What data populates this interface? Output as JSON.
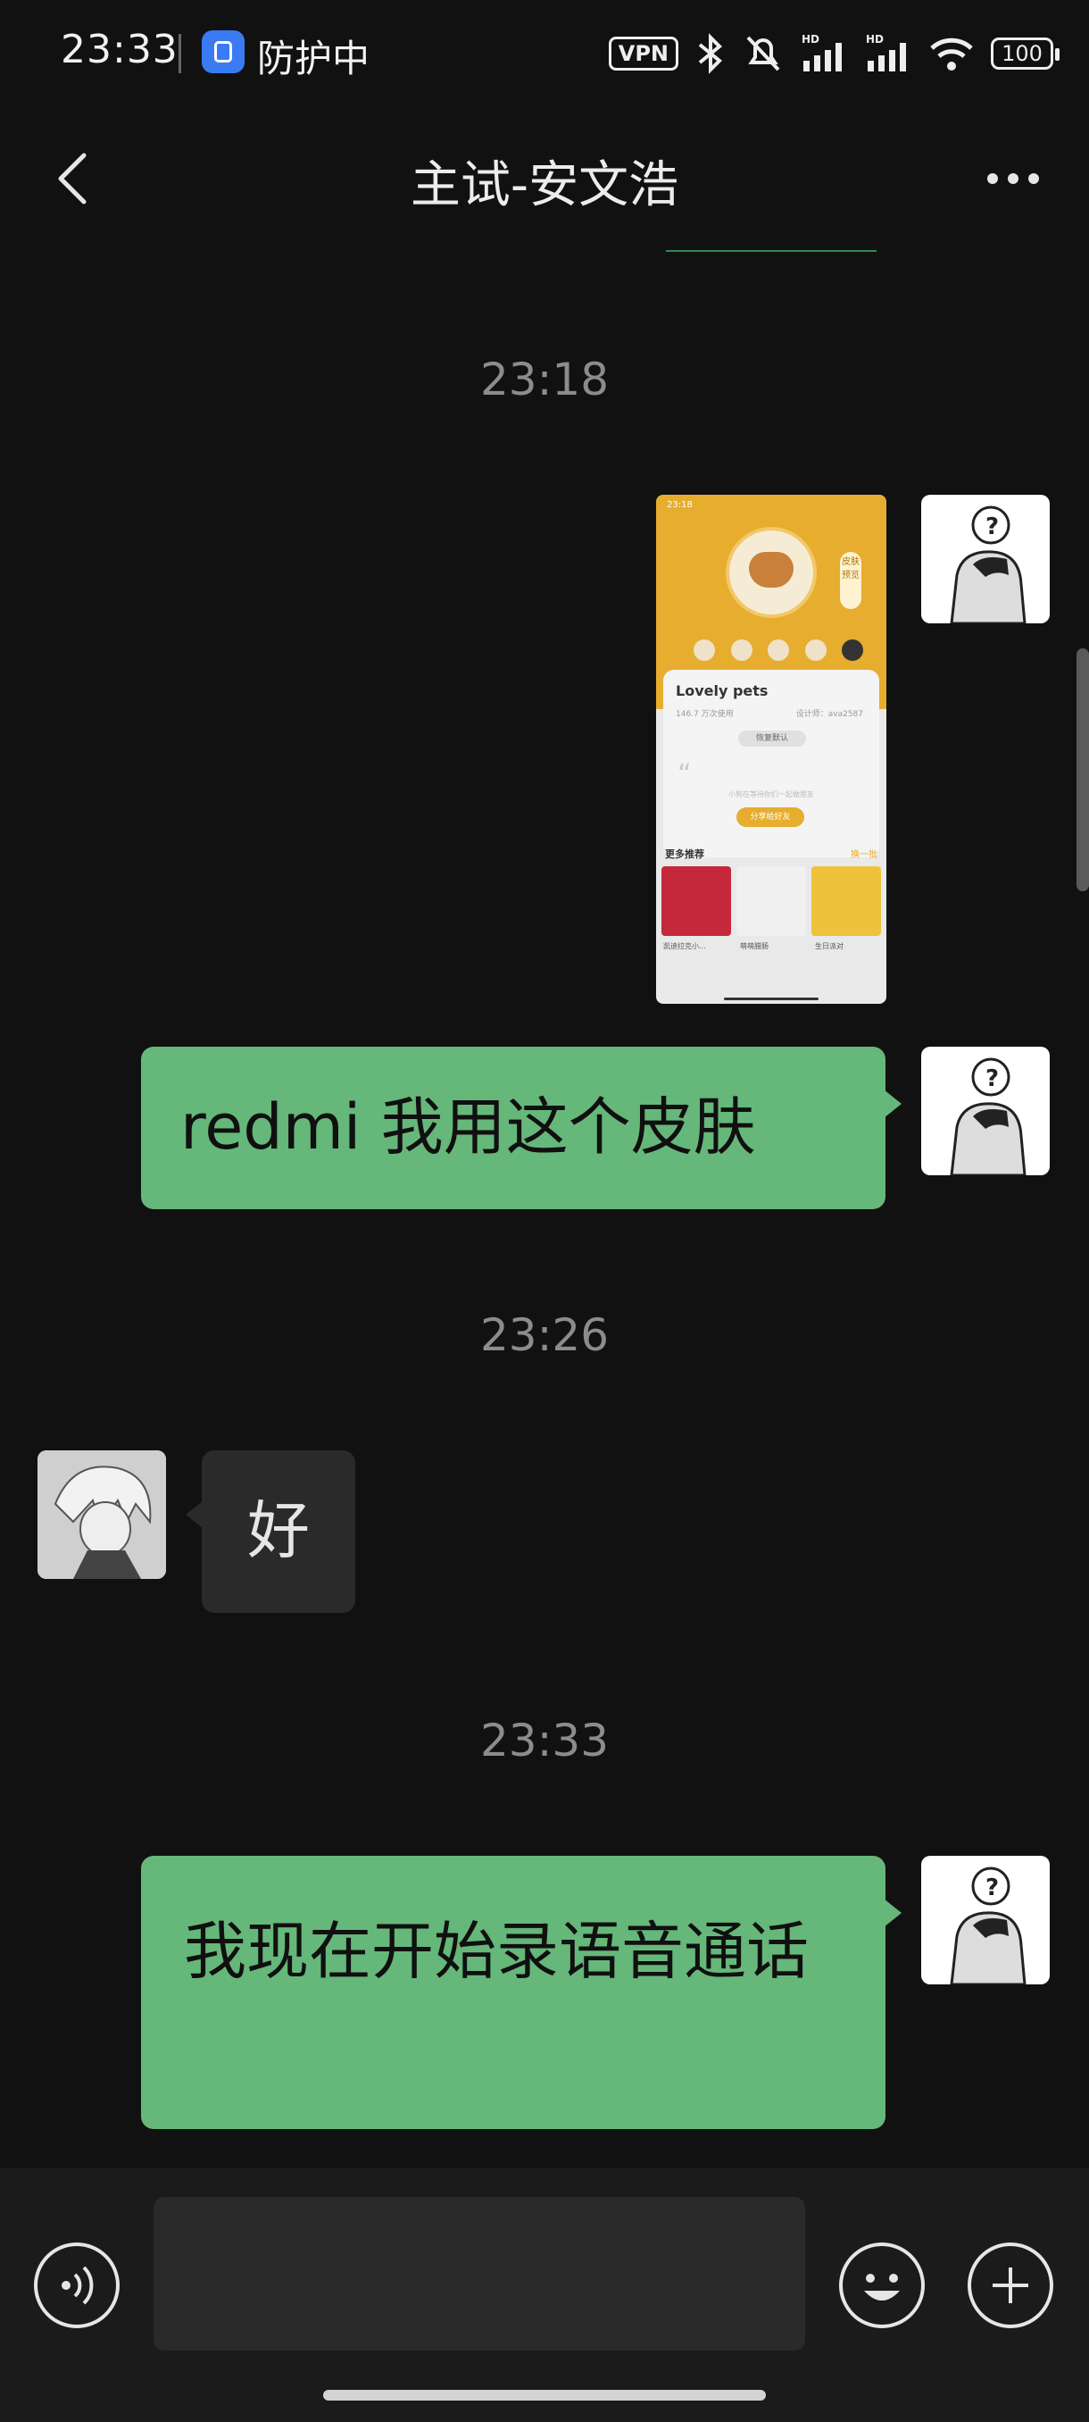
{
  "status_bar": {
    "time": "23:33",
    "protection_label": "防护中",
    "vpn_label": "VPN",
    "battery_level": "100",
    "network_label": "HD"
  },
  "header": {
    "title": "主试-安文浩"
  },
  "messages": [
    {
      "kind": "timestamp",
      "text": "23:18"
    },
    {
      "kind": "image",
      "sender": "me",
      "content": {
        "status_time": "23:18",
        "badge": "皮肤预览",
        "card_title": "Lovely pets",
        "card_sub_left": "146.7 万次使用",
        "card_sub_right": "设计师：ava2587",
        "pill": "恢复默认",
        "hint": "小狗在等待你们一起做朋友",
        "cta": "分享给好友",
        "more_title": "更多推荐",
        "more_link": "换一批",
        "captions": [
          "凯迪拉克小...",
          "萌萌腊肠",
          "生日派对"
        ]
      }
    },
    {
      "kind": "text",
      "sender": "me",
      "text": "redmi 我用这个皮肤"
    },
    {
      "kind": "timestamp",
      "text": "23:26"
    },
    {
      "kind": "text",
      "sender": "other",
      "text": "好"
    },
    {
      "kind": "timestamp",
      "text": "23:33"
    },
    {
      "kind": "text",
      "sender": "me",
      "text": "我现在开始录语音通话"
    }
  ],
  "input": {
    "value": "",
    "placeholder": ""
  },
  "icons": {
    "back": "back-arrow-icon",
    "more": "more-dots-icon",
    "voice": "voice-icon",
    "emoji": "emoji-icon",
    "plus": "plus-icon"
  },
  "colors": {
    "background": "#111111",
    "outgoing_bubble": "#66b77a",
    "incoming_bubble": "#2a2a2a",
    "timestamp": "#8c8c8c",
    "thumbnail_accent": "#e6ad2f"
  }
}
